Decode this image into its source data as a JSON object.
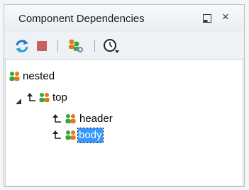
{
  "panel": {
    "title": "Component Dependencies"
  },
  "toolbar": {
    "refresh_icon": "refresh-icon",
    "stop_icon": "stop-icon",
    "show_icon": "people-key-icon",
    "history_icon": "history-dropdown-icon"
  },
  "tree": {
    "root": {
      "label": "nested"
    },
    "top": {
      "label": "top"
    },
    "header": {
      "label": "header"
    },
    "body": {
      "label": "body",
      "selected": true
    }
  },
  "colors": {
    "selection": "#3399ff",
    "refresh_blue": "#1d79c8",
    "stop_red": "#c96060",
    "component_orange": "#e07a1a",
    "component_green": "#3aa63a"
  }
}
